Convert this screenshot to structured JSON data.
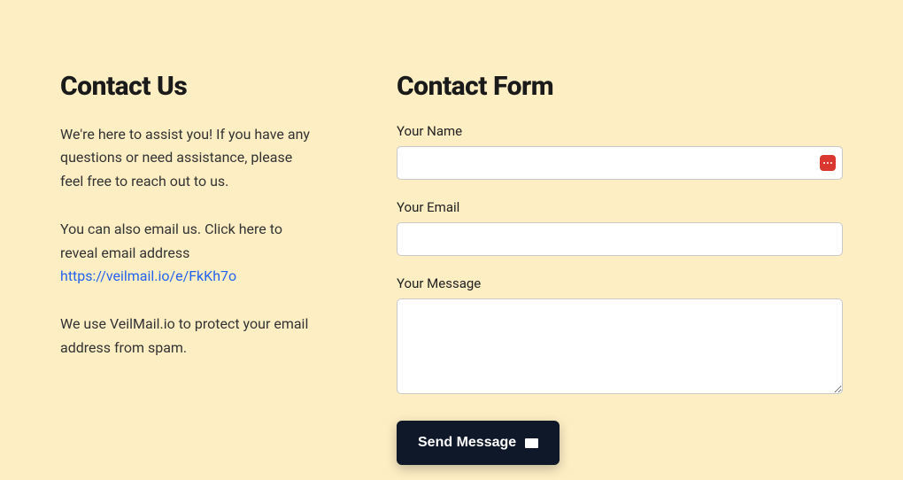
{
  "left": {
    "heading": "Contact Us",
    "para1": "We're here to assist you! If you have any questions or need assistance, please feel free to reach out to us.",
    "para2_pre": "You can also email us. Click here to reveal email address ",
    "link_text": "https://veilmail.io/e/FkKh7o",
    "para3": "We use VeilMail.io to protect your email address from spam."
  },
  "form": {
    "heading": "Contact Form",
    "name_label": "Your Name",
    "email_label": "Your Email",
    "message_label": "Your Message",
    "submit_label": "Send Message"
  }
}
